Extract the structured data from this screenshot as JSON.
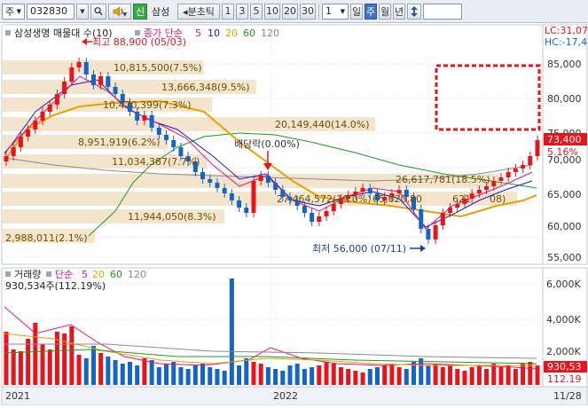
{
  "toolbar": {
    "type_select": "주",
    "code_value": "032830",
    "new_badge": "신",
    "stock_name": "삼성",
    "interval_label": "◂분초틱",
    "intervals": [
      "1",
      "3",
      "5",
      "10",
      "20",
      "30"
    ],
    "count_value": "1",
    "period_day": "일",
    "period_week": "주",
    "period_month": "월",
    "period_year": "년"
  },
  "price_panel": {
    "title": "삼성생명 매물대 수(10)",
    "ma_label": "종가 단순",
    "ma_periods": [
      "5",
      "10",
      "20",
      "60",
      "120"
    ],
    "lc_label": "LC:31,07",
    "hc_label": "HC:-17,4",
    "current_price": "73,400",
    "change_pct": "5.16%",
    "y_ticks": [
      "85,000",
      "80,000",
      "75,000",
      "70,000",
      "65,000",
      "60,000",
      "55,000"
    ],
    "annotations": {
      "high": "최고 88,900 (05/03)",
      "low": "최저 56,000 (07/11)",
      "dividend": "배당락(0.00%)"
    },
    "volume_profile": [
      "10,815,500(7.5%)",
      "13,666,348(9.5%)",
      "10,470,399(7.3%)",
      "20,149,440(14.0%)",
      "8,951,919(6.2%)",
      "11,034,387(7.7%)",
      "26,617,781(18.5%)",
      "27,464,572(19.0%)",
      "65,620,80",
      "621",
      "08)",
      "11,944,050(8.3%)",
      "2,988,011(2.1%)"
    ]
  },
  "volume_panel": {
    "title": "거래량",
    "ma_label": "단순",
    "ma_periods": [
      "5",
      "20",
      "60",
      "120"
    ],
    "last_value": "930,534주(112.19%)",
    "y_ticks": [
      "6,000K",
      "4,000K",
      "2,000K"
    ],
    "badge_value": "930,53",
    "badge_pct": "112.19"
  },
  "x_axis": {
    "labels": [
      "2021",
      "2022"
    ],
    "right_label": "11/28"
  },
  "colors": {
    "up": "#e8141c",
    "down": "#1564c8",
    "ma5": "#e8147f",
    "ma10": "#1a1ad8",
    "ma20": "#e8a000",
    "ma60": "#1f9a1f",
    "ma120": "#8a8a8a",
    "profile": "#f3e3c9"
  }
}
